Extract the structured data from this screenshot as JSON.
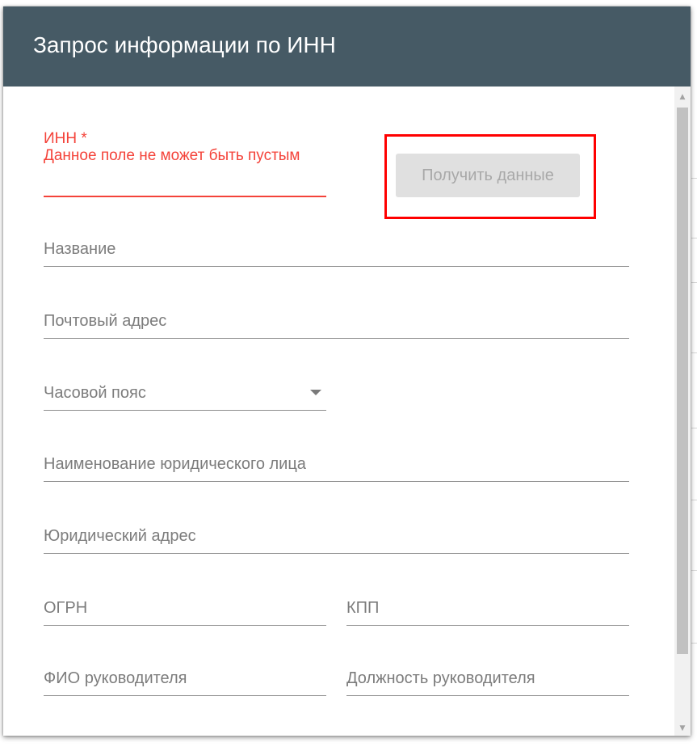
{
  "dialog": {
    "title": "Запрос информации по ИНН"
  },
  "inn": {
    "label": "ИНН *",
    "error": "Данное поле не может быть пустым"
  },
  "get_data_button": {
    "label": "Получить данные",
    "disabled": true
  },
  "fields": {
    "name": "Название",
    "postal_address": "Почтовый адрес",
    "timezone": "Часовой пояс",
    "legal_entity_name": "Наименование юридического лица",
    "legal_address": "Юридический адрес",
    "ogrn": "ОГРН",
    "kpp": "КПП",
    "director_name": "ФИО руководителя",
    "director_position": "Должность руководителя"
  },
  "colors": {
    "header": "#465a65",
    "error": "#f4433a",
    "highlight": "#ff0000"
  },
  "icons": {
    "scroll_up": "triangle-up",
    "scroll_down": "triangle-down",
    "dropdown": "caret-down"
  }
}
